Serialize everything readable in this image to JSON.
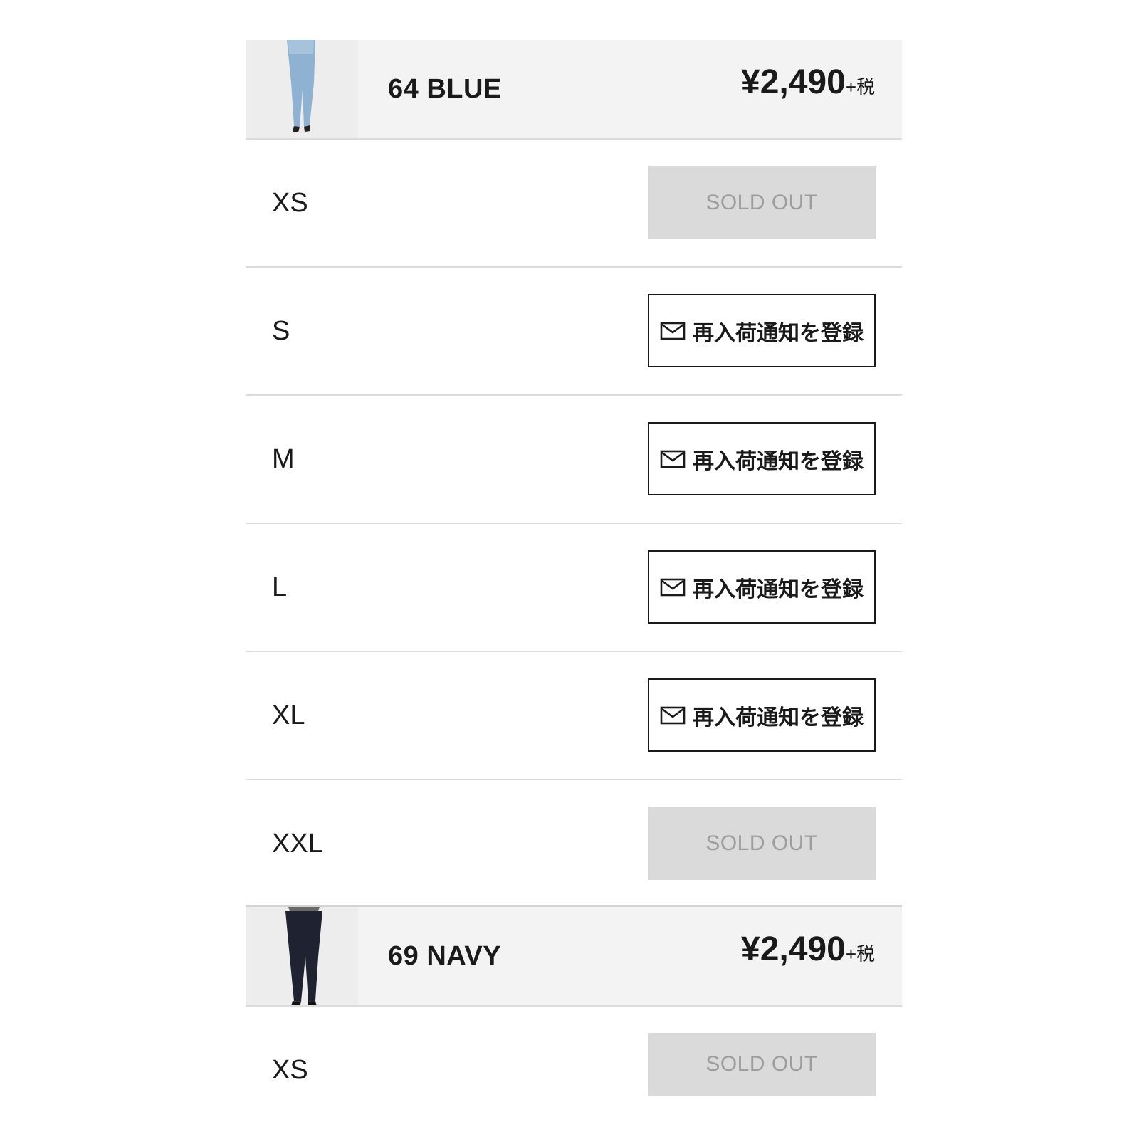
{
  "groups": [
    {
      "color_name": "64 BLUE",
      "price": "¥2,490",
      "tax_suffix": "+税",
      "image_tone": "light-wash-jeans",
      "sizes": [
        {
          "label": "XS",
          "status": "SOLD OUT"
        },
        {
          "label": "S",
          "status": "再入荷通知を登録"
        },
        {
          "label": "M",
          "status": "再入荷通知を登録"
        },
        {
          "label": "L",
          "status": "再入荷通知を登録"
        },
        {
          "label": "XL",
          "status": "再入荷通知を登録"
        },
        {
          "label": "XXL",
          "status": "SOLD OUT"
        }
      ]
    },
    {
      "color_name": "69 NAVY",
      "price": "¥2,490",
      "tax_suffix": "+税",
      "image_tone": "dark-navy-jeans",
      "sizes": [
        {
          "label": "XS",
          "status": "SOLD OUT"
        }
      ]
    }
  ],
  "colors": {
    "header_bg": "#f3f3f3",
    "soldout_bg": "#dadada",
    "soldout_text": "#9d9d9d",
    "divider": "#dcdcdc",
    "text": "#1a1a1a"
  },
  "icons": {
    "notify": "mail-icon"
  }
}
